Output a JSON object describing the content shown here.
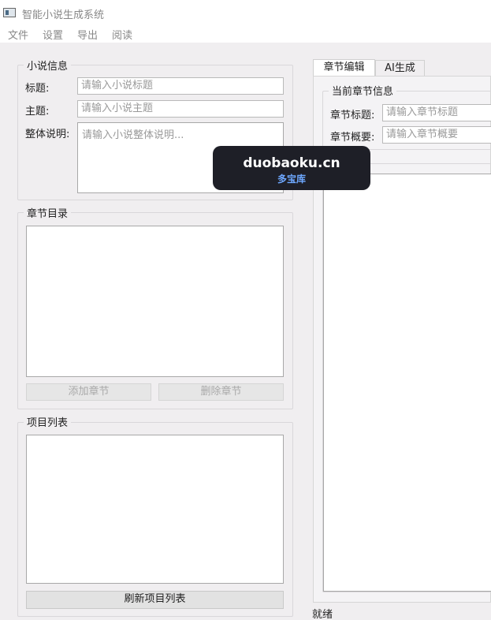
{
  "window": {
    "title": "智能小说生成系统"
  },
  "menu": {
    "items": [
      "文件",
      "设置",
      "导出",
      "阅读"
    ]
  },
  "novel_info": {
    "group_title": "小说信息",
    "title_label": "标题:",
    "title_placeholder": "请输入小说标题",
    "theme_label": "主题:",
    "theme_placeholder": "请输入小说主题",
    "desc_label": "整体说明:",
    "desc_placeholder": "请输入小说整体说明..."
  },
  "chapters": {
    "group_title": "章节目录",
    "add_button": "添加章节",
    "delete_button": "删除章节"
  },
  "projects": {
    "group_title": "项目列表",
    "refresh_button": "刷新项目列表"
  },
  "tabs": {
    "items": [
      "章节编辑",
      "AI生成"
    ],
    "active": 0
  },
  "chapter_info": {
    "group_title": "当前章节信息",
    "title_label": "章节标题:",
    "title_placeholder": "请输入章节标题",
    "summary_label": "章节概要:",
    "summary_placeholder": "请输入章节概要"
  },
  "content": {
    "group_title_partial": "内容"
  },
  "watermark": {
    "main": "duobaoku.cn",
    "sub": "多宝库"
  },
  "status": {
    "text": "就绪"
  }
}
